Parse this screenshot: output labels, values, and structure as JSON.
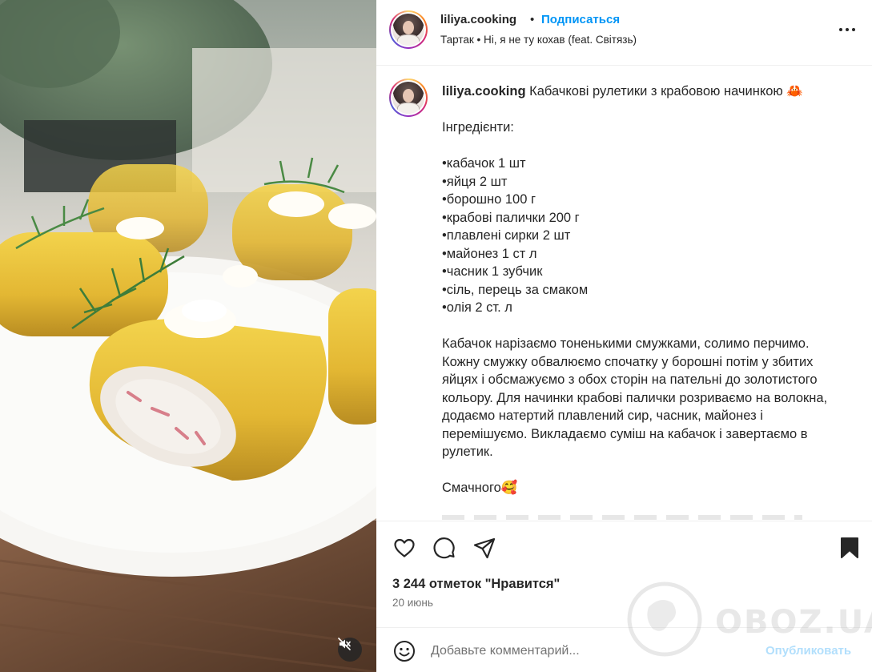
{
  "header": {
    "username": "liliya.cooking",
    "separator": "•",
    "follow_label": "Подписаться",
    "music": "Тартак • Ні, я не ту кохав (feat. Світязь)"
  },
  "caption": {
    "username": "liliya.cooking",
    "title": "Кабачкові рулетики з крабовою начинкою 🦀",
    "ingredients_heading": "Інгредієнти:",
    "ingredients": [
      "•кабачок 1 шт",
      "•яйця 2 шт",
      "•борошно 100 г",
      "•крабові палички 200 г",
      "•плавлені сирки 2 шт",
      "•майонез 1 ст л",
      "•часник 1 зубчик",
      "•сіль, перець за смаком",
      "•олія 2 ст. л"
    ],
    "instructions": "Кабачок нарізаємо тоненькими смужками, солимо перчимо. Кожну смужку обвалюємо спочатку у борошні потім у збитих яйцях і обсмажуємо з обох сторін на пательні до золотистого кольору. Для начинки крабові палички розриваємо на волокна, додаємо натертий плавлений сир, часник, майонез і перемішуємо. Викладаємо суміш на кабачок і завертаємо в рулетик.",
    "closing": "Смачного🥰"
  },
  "actions": {
    "like_icon": "heart-icon",
    "comment_icon": "comment-icon",
    "share_icon": "paper-plane-icon",
    "save_icon": "bookmark-icon"
  },
  "likes": "3 244 отметок \"Нравится\"",
  "date": "20 июнь",
  "comment": {
    "placeholder": "Добавьте комментарий...",
    "publish_label": "Опубликовать",
    "emoji_icon": "smiley-icon"
  },
  "media": {
    "mute_icon": "speaker-muted-icon"
  },
  "watermark": {
    "text": "OBOZ.UA"
  },
  "colors": {
    "accent": "#0095f6",
    "text": "#262626",
    "secondary": "#737373",
    "publish_disabled": "#b2dffc"
  }
}
